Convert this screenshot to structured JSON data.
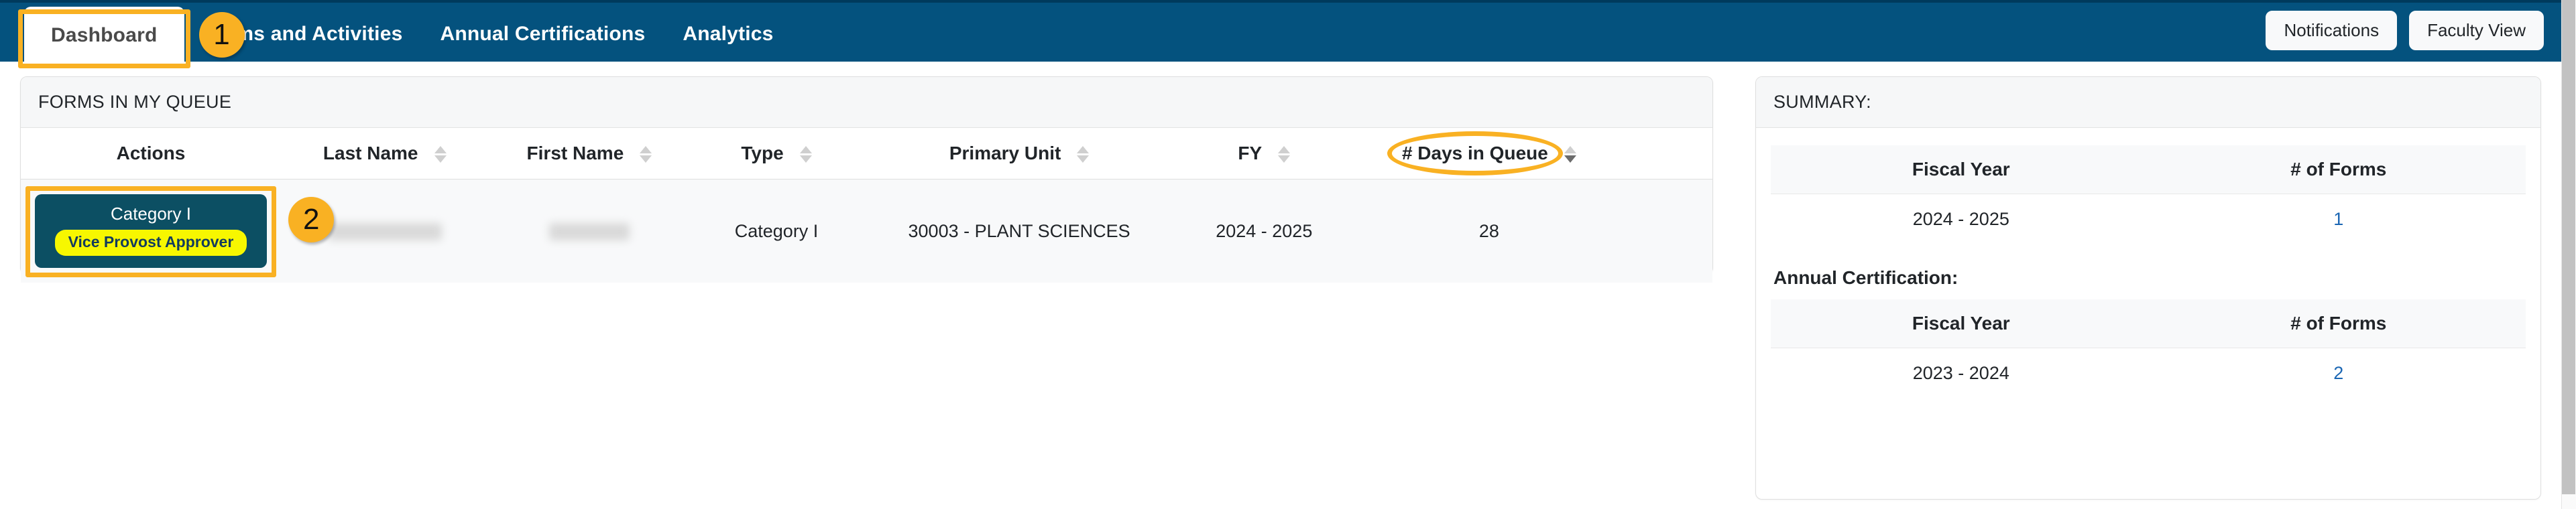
{
  "nav": {
    "tabs": [
      {
        "label": "Dashboard",
        "active": true
      },
      {
        "label": "Forms and Activities",
        "active": false
      },
      {
        "label": "Annual Certifications",
        "active": false
      },
      {
        "label": "Analytics",
        "active": false
      }
    ],
    "buttons": [
      {
        "label": "Notifications"
      },
      {
        "label": "Faculty View"
      }
    ]
  },
  "queue_panel": {
    "title": "FORMS IN MY QUEUE",
    "columns": [
      {
        "label": "Actions",
        "sortable": false
      },
      {
        "label": "Last Name",
        "sortable": true
      },
      {
        "label": "First Name",
        "sortable": true
      },
      {
        "label": "Type",
        "sortable": true
      },
      {
        "label": "Primary Unit",
        "sortable": true
      },
      {
        "label": "FY",
        "sortable": true
      },
      {
        "label": "# Days in Queue",
        "sortable": true,
        "sorted": "desc"
      }
    ],
    "rows": [
      {
        "action": {
          "title": "Category I",
          "pill": "Vice Provost Approver"
        },
        "last_name": "",
        "first_name": "",
        "type": "Category I",
        "primary_unit": "30003 - PLANT SCIENCES",
        "fy": "2024 - 2025",
        "days_in_queue": "28"
      }
    ]
  },
  "summary_panel": {
    "title": "SUMMARY:",
    "tables": [
      {
        "subtitle": "",
        "columns": [
          "Fiscal Year",
          "# of Forms"
        ],
        "rows": [
          {
            "fiscal_year": "2024 - 2025",
            "forms": "1"
          }
        ]
      },
      {
        "subtitle": "Annual Certification:",
        "columns": [
          "Fiscal Year",
          "# of Forms"
        ],
        "rows": [
          {
            "fiscal_year": "2023 - 2024",
            "forms": "2"
          }
        ]
      }
    ]
  },
  "annotations": [
    {
      "badge": "1",
      "target": "dashboard-tab"
    },
    {
      "badge": "2",
      "target": "category-button"
    }
  ],
  "colors": {
    "nav_background": "#04527e",
    "annotation": "#f9b123",
    "category_button": "#0c4f63",
    "category_pill": "#f7f700",
    "link": "#1b66b3"
  }
}
